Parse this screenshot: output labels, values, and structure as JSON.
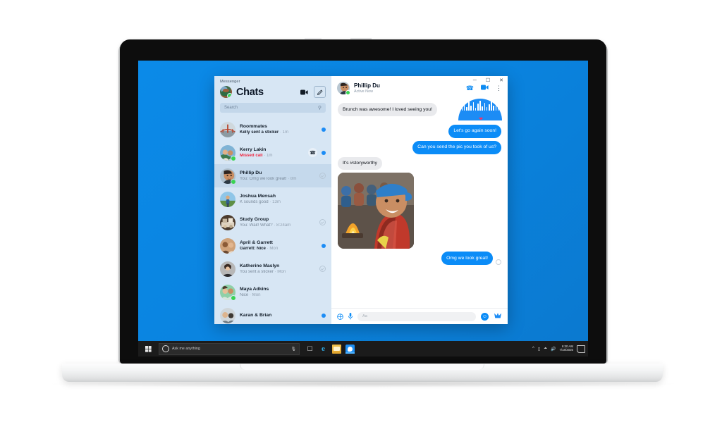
{
  "desktop": {
    "wallpaper_color": "#0a84e0",
    "taskbar": {
      "start_label": "Start",
      "search_placeholder": "Ask me anything",
      "mic_icon": "microphone-icon",
      "items": [
        {
          "name": "task-view",
          "label": "Task View"
        },
        {
          "name": "edge",
          "label": "Microsoft Edge"
        },
        {
          "name": "file-explorer",
          "label": "File Explorer"
        },
        {
          "name": "messenger",
          "label": "Messenger"
        }
      ],
      "tray": {
        "chevron": "^",
        "network_icon": "network-icon",
        "wifi_icon": "wifi-icon",
        "volume_icon": "volume-icon",
        "time": "6:30 AM",
        "date": "7/18/2025",
        "action_center": "action-center-icon"
      }
    }
  },
  "window": {
    "app_name": "Messenger",
    "controls": {
      "minimize": "─",
      "maximize": "☐",
      "close": "✕"
    }
  },
  "sidebar": {
    "title": "Chats",
    "me_status": "online",
    "new_video_call_icon": "video-camera-icon",
    "compose_icon": "compose-pencil-icon",
    "search": {
      "placeholder": "Search",
      "icon": "search-icon"
    },
    "chats": [
      {
        "name": "Roommates",
        "preview": "Kelly sent a sticker",
        "preview_bold": true,
        "time": "1m",
        "status": "unread",
        "avatar": "bridge",
        "online": false,
        "selected": false
      },
      {
        "name": "Kerry Lakin",
        "preview": "Missed call",
        "missed": true,
        "time": "1m",
        "status": "unread",
        "avatar": "couple",
        "online": true,
        "selected": false,
        "call_back_icon": "phone-icon"
      },
      {
        "name": "Phillip Du",
        "preview": "You: Omg we look great!",
        "preview_bold": false,
        "time": "8m",
        "status": "seen",
        "avatar": "phillip",
        "online": true,
        "selected": true
      },
      {
        "name": "Joshua Mensah",
        "preview": "K sounds good",
        "preview_bold": false,
        "time": "13m",
        "status": "none",
        "avatar": "hiker",
        "online": false,
        "selected": false
      },
      {
        "name": "Study Group",
        "preview": "You: Wait! What?",
        "preview_bold": false,
        "time": "8:24am",
        "status": "seen",
        "avatar": "books",
        "online": false,
        "selected": false
      },
      {
        "name": "April & Garrett",
        "preview": "Garrett: Nice",
        "preview_bold": true,
        "time": "Mon",
        "status": "unread",
        "avatar": "pair",
        "online": false,
        "selected": false
      },
      {
        "name": "Katherine Maslyn",
        "preview": "You sent a sticker",
        "preview_bold": false,
        "time": "Mon",
        "status": "seen",
        "avatar": "katherine",
        "online": false,
        "selected": false
      },
      {
        "name": "Maya Adkins",
        "preview": "Nice",
        "preview_bold": false,
        "time": "Mon",
        "status": "none",
        "avatar": "maya",
        "online": true,
        "selected": false
      },
      {
        "name": "Karan & Brian",
        "preview": "",
        "preview_bold": true,
        "time": "",
        "status": "unread",
        "avatar": "karan",
        "online": false,
        "selected": false
      }
    ]
  },
  "thread": {
    "contact_name": "Phillip Du",
    "contact_status": "Active Now",
    "audio_call_icon": "phone-icon",
    "video_call_icon": "video-camera-icon",
    "more_icon": "kebab-menu-icon",
    "waveform_label": "voice-waveform",
    "messages": [
      {
        "from": "them",
        "text": "Brunch was awesome! I loved seeing you!",
        "reaction": "❤"
      },
      {
        "from": "me",
        "text": "Let's go again soon!"
      },
      {
        "from": "me",
        "text": "Can you send the pic you took of us?"
      },
      {
        "from": "them",
        "text": "It's #storyworthy"
      },
      {
        "from": "them",
        "type": "photo",
        "alt": "campfire-photo"
      },
      {
        "from": "me",
        "text": "Omg we look great!",
        "sent": true
      }
    ],
    "composer": {
      "add_icon": "plus-circle-icon",
      "mic_icon": "microphone-icon",
      "placeholder": "Aa",
      "emoji_icon": "smiley-icon",
      "like_icon": "thumbs-up-icon"
    }
  },
  "colors": {
    "accent_blue": "#0b8cf7",
    "wallpaper": "#0a84e0",
    "sidebar": "#d7e6f4",
    "sidebar_selected": "#c5d9ec",
    "bubble_them": "#e9eaed",
    "missed_call_red": "#f0253f",
    "online_green": "#39d353"
  }
}
